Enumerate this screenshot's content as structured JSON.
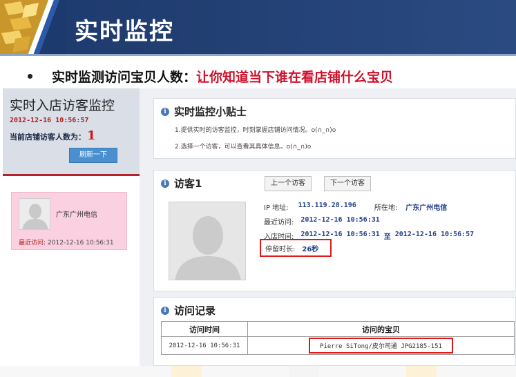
{
  "slide": {
    "title": "实时监控",
    "bullet_prefix": "实时监测访问宝贝人数：",
    "bullet_highlight": "让你知道当下谁在看店铺什么宝贝"
  },
  "sidebar": {
    "title": "实时入店访客监控",
    "timestamp": "2012-12-16 10:56:57",
    "visitor_count_label": "当前店铺访客人数为：",
    "visitor_count": "1",
    "refresh_label": "刷新一下",
    "visitor_card": {
      "name": "广东广州电信",
      "last_visit_label": "最近访问:",
      "last_visit_time": "2012-12-16 10:56:31"
    }
  },
  "tips": {
    "title": "实时监控小贴士",
    "items": [
      "1.提供实时的访客监控，时刻掌握店铺访问情况。o(∩_∩)o",
      "2.选择一个访客，可以查看其具体信息。o(∩_∩)o"
    ]
  },
  "visitor": {
    "title": "访客1",
    "ip_label": "IP 地址:",
    "ip": "113.119.28.196",
    "location_label": "所在地:",
    "location": "广东广州电信",
    "last_visit_label": "最近访问:",
    "last_visit": "2012-12-16 10:56:31",
    "enter_time_label": "入店时间:",
    "enter_start": "2012-12-16 10:56:31",
    "enter_to": "至",
    "enter_end": "2012-12-16 10:56:57",
    "stay_label": "停留时长:",
    "stay_value": "26秒",
    "prev_label": "上一个访客",
    "next_label": "下一个访客"
  },
  "records": {
    "title": "访问记录",
    "headers": [
      "访问时间",
      "访问的宝贝"
    ],
    "rows": [
      [
        "2012-12-16 10:56:31",
        "Pierre SiTong/皮尔司通 JPG2185-151"
      ]
    ]
  },
  "colors": {
    "banner": "#223f72",
    "accent_red": "#d0112b",
    "link_blue": "#213e8c",
    "button_blue": "#4a90d0",
    "card_pink": "#fbd0e0"
  }
}
